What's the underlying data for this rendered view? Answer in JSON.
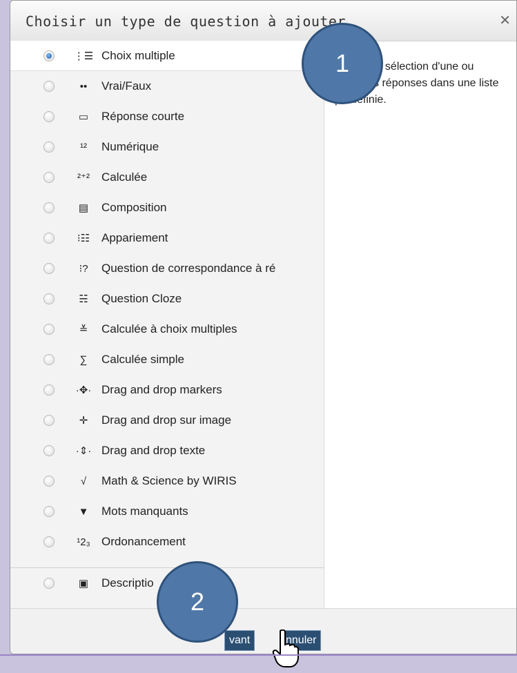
{
  "dialog": {
    "title": "Choisir un type de question à ajouter",
    "close_glyph": "✕",
    "description": "Permet la sélection d'une ou plusieurs réponses dans une liste prédéfinie."
  },
  "question_types": [
    {
      "label": "Choix multiple",
      "icon": "multiple-choice-icon",
      "glyph": "⋮☰",
      "selected": true
    },
    {
      "label": "Vrai/Faux",
      "icon": "true-false-icon",
      "glyph": "••",
      "selected": false
    },
    {
      "label": "Réponse courte",
      "icon": "short-answer-icon",
      "glyph": "▭",
      "selected": false
    },
    {
      "label": "Numérique",
      "icon": "numerical-icon",
      "glyph": "¹²",
      "selected": false
    },
    {
      "label": "Calculée",
      "icon": "calculated-icon",
      "glyph": "²⁺²",
      "selected": false
    },
    {
      "label": "Composition",
      "icon": "essay-icon",
      "glyph": "▤",
      "selected": false
    },
    {
      "label": "Appariement",
      "icon": "matching-icon",
      "glyph": "⁝☷",
      "selected": false
    },
    {
      "label": "Question de correspondance à ré",
      "icon": "random-matching-icon",
      "glyph": "⁝?",
      "selected": false
    },
    {
      "label": "Question Cloze",
      "icon": "cloze-icon",
      "glyph": "☵",
      "selected": false
    },
    {
      "label": "Calculée à choix multiples",
      "icon": "calculated-multichoice-icon",
      "glyph": "≚",
      "selected": false
    },
    {
      "label": "Calculée simple",
      "icon": "calculated-simple-icon",
      "glyph": "∑",
      "selected": false
    },
    {
      "label": "Drag and drop markers",
      "icon": "drag-drop-markers-icon",
      "glyph": "·✥·",
      "selected": false
    },
    {
      "label": "Drag and drop sur image",
      "icon": "drag-drop-image-icon",
      "glyph": "✛",
      "selected": false
    },
    {
      "label": "Drag and drop texte",
      "icon": "drag-drop-text-icon",
      "glyph": "·⇕·",
      "selected": false
    },
    {
      "label": "Math & Science by WIRIS",
      "icon": "wiris-icon",
      "glyph": "√",
      "selected": false
    },
    {
      "label": "Mots manquants",
      "icon": "dropdown-arrow-icon",
      "glyph": "▼",
      "selected": false
    },
    {
      "label": "Ordonancement",
      "icon": "ordering-icon",
      "glyph": "¹2₃",
      "selected": false
    },
    {
      "label": "Descriptio",
      "icon": "description-icon",
      "glyph": "▣",
      "selected": false
    }
  ],
  "footer": {
    "next_label": "vant",
    "cancel_label": "nnuler"
  },
  "badges": {
    "one": "1",
    "two": "2"
  },
  "colors": {
    "badge_fill": "#4f78a8",
    "button_fill": "#2b4f73",
    "page_background": "#c9c3dd"
  }
}
